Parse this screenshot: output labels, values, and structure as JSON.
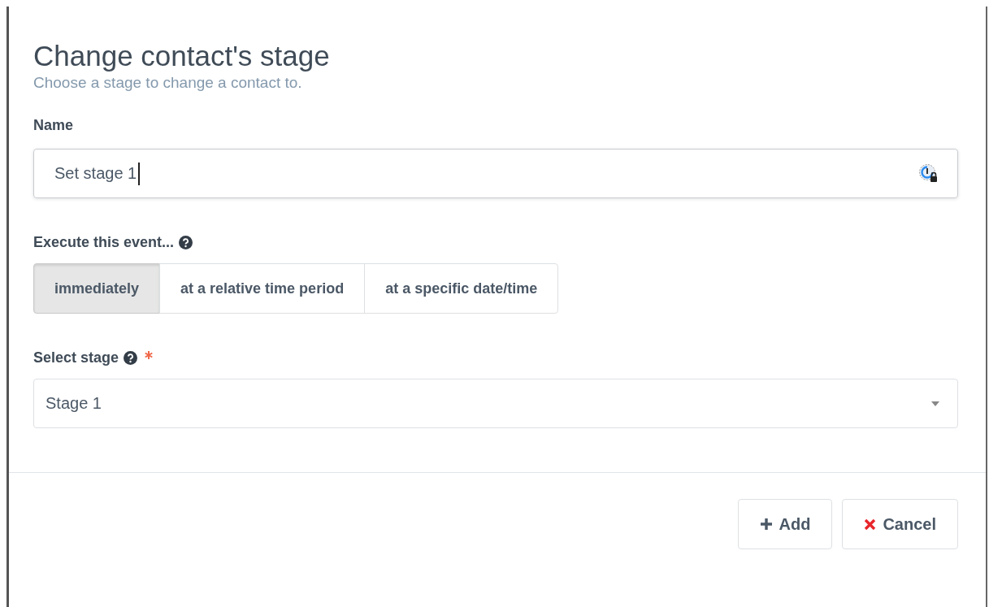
{
  "dialog": {
    "title": "Change contact's stage",
    "subtitle": "Choose a stage to change a contact to."
  },
  "name_field": {
    "label": "Name",
    "value": "Set stage 1"
  },
  "execute": {
    "label": "Execute this event...",
    "options": [
      {
        "label": "immediately",
        "selected": true
      },
      {
        "label": "at a relative time period",
        "selected": false
      },
      {
        "label": "at a specific date/time",
        "selected": false
      }
    ]
  },
  "stage": {
    "label": "Select stage",
    "required": true,
    "value": "Stage 1"
  },
  "buttons": [
    {
      "kind": "add",
      "label": "Add"
    },
    {
      "kind": "cancel",
      "label": "Cancel"
    }
  ]
}
